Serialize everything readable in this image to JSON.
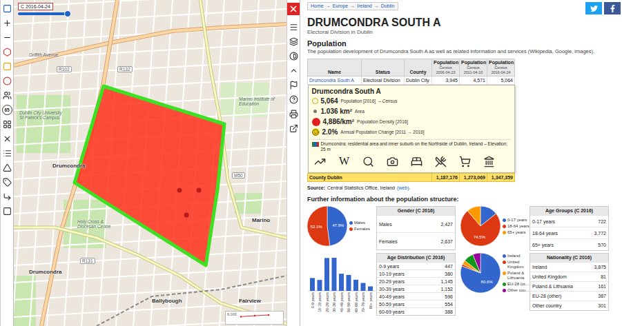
{
  "time_slider": {
    "label": "C 2016-04-24",
    "level": 1
  },
  "left_toolbar": {
    "age_badge": "65"
  },
  "map": {
    "labels": [
      {
        "text": "Griffith Avenue",
        "kind": "street"
      },
      {
        "text": "R102",
        "kind": "road"
      },
      {
        "text": "R132",
        "kind": "road"
      },
      {
        "text": "Dublin City University St Patrick's Campus",
        "kind": "poi"
      },
      {
        "text": "Drumcondra",
        "kind": "place"
      },
      {
        "text": "Marino Institute of Education",
        "kind": "poi"
      },
      {
        "text": "M50",
        "kind": "road"
      },
      {
        "text": "Marino",
        "kind": "place"
      },
      {
        "text": "Holy Cross & Diocesan Centre",
        "kind": "poi"
      },
      {
        "text": "R131",
        "kind": "road"
      },
      {
        "text": "Drumcondra",
        "kind": "place"
      },
      {
        "text": "Ballybough",
        "kind": "place"
      },
      {
        "text": "Fairview",
        "kind": "place"
      }
    ],
    "mini_chart": {
      "tick": "6,000",
      "values": [
        3945,
        4571,
        5064
      ]
    }
  },
  "breadcrumb": {
    "items": [
      "Home",
      "Europe",
      "Ireland",
      "Dublin"
    ],
    "separator": "→"
  },
  "title": "DRUMCONDRA SOUTH A",
  "subtitle": "Electoral Division in Dublin",
  "population": {
    "heading": "Population",
    "intro": "The population development of Drumcondra South A as well as related information and services (Wikipedia, Google, images)."
  },
  "table": {
    "columns": [
      {
        "label": "Name"
      },
      {
        "label": "Status"
      },
      {
        "label": "County"
      },
      {
        "label": "Population",
        "sub": "Census",
        "date": "2006-04-23"
      },
      {
        "label": "Population",
        "sub": "Census",
        "date": "2011-04-10"
      },
      {
        "label": "Population",
        "sub": "Census",
        "date": "2016-04-24"
      }
    ],
    "rows": [
      {
        "cells": [
          "Drumcondra South A",
          "Electoral Division",
          "Dublin City",
          "3,945",
          "4,571",
          "5,064"
        ]
      }
    ],
    "total": {
      "name": "County Dublin",
      "values": [
        "1,187,176",
        "1,273,069",
        "1,347,359"
      ]
    }
  },
  "popup": {
    "title": "Drumcondra South A",
    "items": [
      {
        "kind": "population",
        "value": "5,064",
        "label": "Population [2016]",
        "note": "– Census"
      },
      {
        "kind": "area",
        "value": "1.036 km²",
        "label": "Area"
      },
      {
        "kind": "density",
        "value": "4,886/km²",
        "label": "Population Density [2016]"
      },
      {
        "kind": "change",
        "value": "2.0%",
        "label": "Annual Population Change [2011 → 2016]"
      }
    ],
    "description": "Drumcondra: residential area and inner suburb on the Northside of Dublin, Ireland – Elevation: 25 m",
    "links": [
      {
        "kind": "chart"
      },
      {
        "kind": "wiki",
        "text": "W"
      },
      {
        "kind": "search"
      },
      {
        "kind": "photo"
      },
      {
        "kind": "hotel"
      },
      {
        "kind": "restaurant"
      },
      {
        "kind": "shopping"
      },
      {
        "kind": "museum"
      }
    ]
  },
  "source": {
    "label": "Source:",
    "text": "Central Statistics Office, Ireland",
    "link": "(web)",
    "end": "."
  },
  "structure": {
    "heading": "Further information about the population structure:",
    "gender": {
      "title": "Gender (C 2016)",
      "slices": [
        {
          "name": "Males",
          "legend": "Males",
          "value": 2427,
          "display": "2,427",
          "pct": "47.9%",
          "color": "#3366cc"
        },
        {
          "name": "Females",
          "legend": "Females",
          "value": 2637,
          "display": "2,637",
          "pct": "52.1%",
          "color": "#dc3912"
        }
      ]
    },
    "age_groups": {
      "title": "Age Groups (C 2016)",
      "slices": [
        {
          "name": "0-17 years",
          "legend": "0-17 years",
          "value": 722,
          "display": "722",
          "color": "#3366cc"
        },
        {
          "name": "18-64 years",
          "legend": "18-64 years",
          "value": 3772,
          "display": "3,772",
          "pct": "74.5%",
          "color": "#dc3912"
        },
        {
          "name": "65+ years",
          "legend": "65+ years",
          "value": 570,
          "display": "570",
          "color": "#ff9900"
        }
      ]
    },
    "age_distribution": {
      "title": "Age Distribution (C 2016)",
      "bars": [
        {
          "label": "0-9 years",
          "value": 447
        },
        {
          "label": "10-19 years",
          "value": 380
        },
        {
          "label": "20-29 years",
          "value": 1145
        },
        {
          "label": "30-39 years",
          "value": 1152
        },
        {
          "label": "40-49 years",
          "value": 596
        },
        {
          "label": "50-59 years",
          "value": 554
        },
        {
          "label": "60-69 years",
          "value": 388
        },
        {
          "label": "70-79 years",
          "value": 276
        },
        {
          "label": "80+ years",
          "value": 156
        }
      ],
      "rows": [
        {
          "label": "0-9 years",
          "value": "447"
        },
        {
          "label": "10-19 years",
          "value": "380"
        },
        {
          "label": "20-29 years",
          "value": "1,145"
        },
        {
          "label": "30-39 years",
          "value": "1,152"
        },
        {
          "label": "40-49 years",
          "value": "596"
        },
        {
          "label": "50-59 years",
          "value": "554"
        },
        {
          "label": "60-69 years",
          "value": "388"
        }
      ]
    },
    "nationality": {
      "title": "Nationality (C 2016)",
      "slices": [
        {
          "name": "Ireland",
          "legend": "Ireland",
          "value": 3875,
          "display": "3,875",
          "pct": "80.6%",
          "color": "#3366cc"
        },
        {
          "name": "United Kingdom",
          "legend": "United Kingdom",
          "value": 81,
          "display": "81",
          "color": "#dc3912"
        },
        {
          "name": "Poland & Lithuania",
          "legend": "Poland & Lithuania",
          "value": 161,
          "display": "161",
          "color": "#ff9900"
        },
        {
          "name": "EU-28 (other)",
          "legend": "EU-28 (ot...",
          "value": 387,
          "display": "387",
          "color": "#109618"
        },
        {
          "name": "Other country",
          "legend": "Other cou...",
          "value": 301,
          "display": "301",
          "color": "#990099"
        }
      ]
    }
  }
}
